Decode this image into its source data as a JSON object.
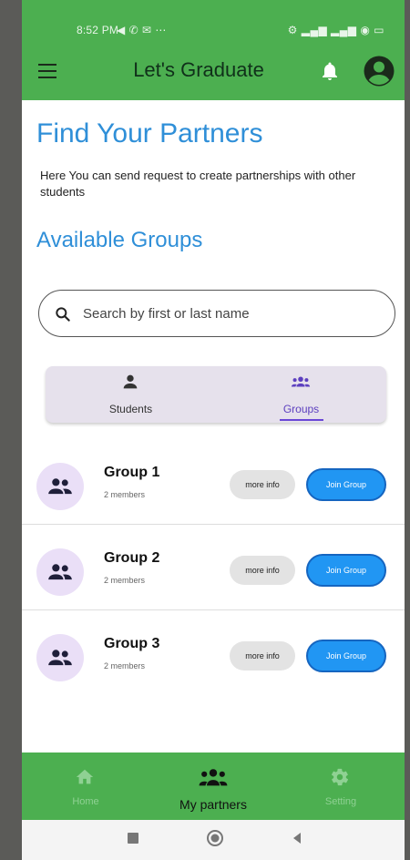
{
  "status_bar": {
    "time": "8:52 PM",
    "icons": "◀ ✆ ✉ ⋯",
    "right_icons": "⚙ ▂▄▆ ▂▄▆ ◉ ▭"
  },
  "app_bar": {
    "title": "Let's Graduate",
    "icons": [
      "menu-icon",
      "bell-icon",
      "account-icon"
    ]
  },
  "page": {
    "title": "Find Your Partners",
    "description": "Here You can send request to create partnerships with other students",
    "section_title": "Available Groups"
  },
  "search": {
    "placeholder": "Search by first or last name",
    "value": ""
  },
  "tabs": [
    {
      "label": "Students",
      "icon": "person-icon",
      "active": false
    },
    {
      "label": "Groups",
      "icon": "groups-icon",
      "active": true
    }
  ],
  "groups": [
    {
      "name": "Group 1",
      "members": "2 members",
      "more_info": "more info",
      "join": "Join Group"
    },
    {
      "name": "Group 2",
      "members": "2 members",
      "more_info": "more info",
      "join": "Join Group"
    },
    {
      "name": "Group 3",
      "members": "2 members",
      "more_info": "more info",
      "join": "Join Group"
    }
  ],
  "bottom_nav": [
    {
      "label": "Home",
      "icon": "home-icon",
      "active": false
    },
    {
      "label": "My partners",
      "icon": "groups-icon",
      "active": true
    },
    {
      "label": "Setting",
      "icon": "gear-icon",
      "active": false
    }
  ],
  "colors": {
    "primary_green": "#4caf50",
    "heading_blue": "#2f8fd8",
    "join_blue": "#2196f3",
    "tab_accent": "#6a47d6",
    "avatar_bg": "#eadff7"
  }
}
